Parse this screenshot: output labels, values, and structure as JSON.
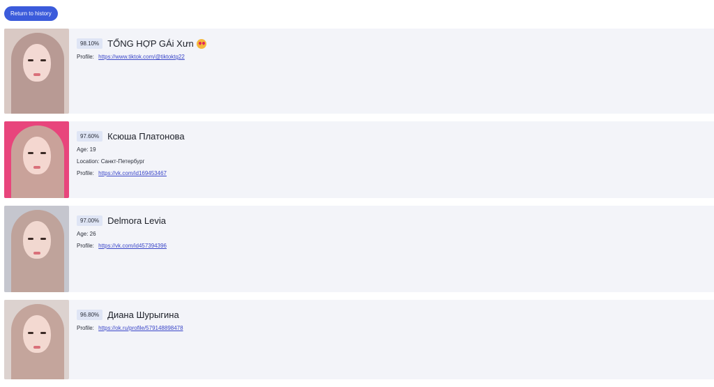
{
  "toolbar": {
    "back_label": "Return to history"
  },
  "results": [
    {
      "score": "98.10%",
      "name": "TỔNG HỢP GÁi Xưn",
      "profile_label": "Profile:",
      "profile_url": "https://www.tiktok.com/@tiktoktg22",
      "emoji": "smiling-face-with-heart-eyes"
    },
    {
      "score": "97.60%",
      "name": "Ксюша Платонова",
      "age_label": "Age: 19",
      "location_label": "Location: Санкт-Петербург",
      "profile_label": "Profile:",
      "profile_url": "https://vk.com/id169453467"
    },
    {
      "score": "97.00%",
      "name": "Delmora Levia",
      "age_label": "Age: 26",
      "profile_label": "Profile:",
      "profile_url": "https://vk.com/id457394396"
    },
    {
      "score": "96.80%",
      "name": "Диана Шурыгина",
      "profile_label": "Profile:",
      "profile_url": "https://ok.ru/profile/579148898478"
    }
  ],
  "colors": {
    "accent": "#3b5bdb",
    "card_bg": "#f3f4f9",
    "score_bg": "#dfe5f5",
    "link": "#3a46c8"
  }
}
